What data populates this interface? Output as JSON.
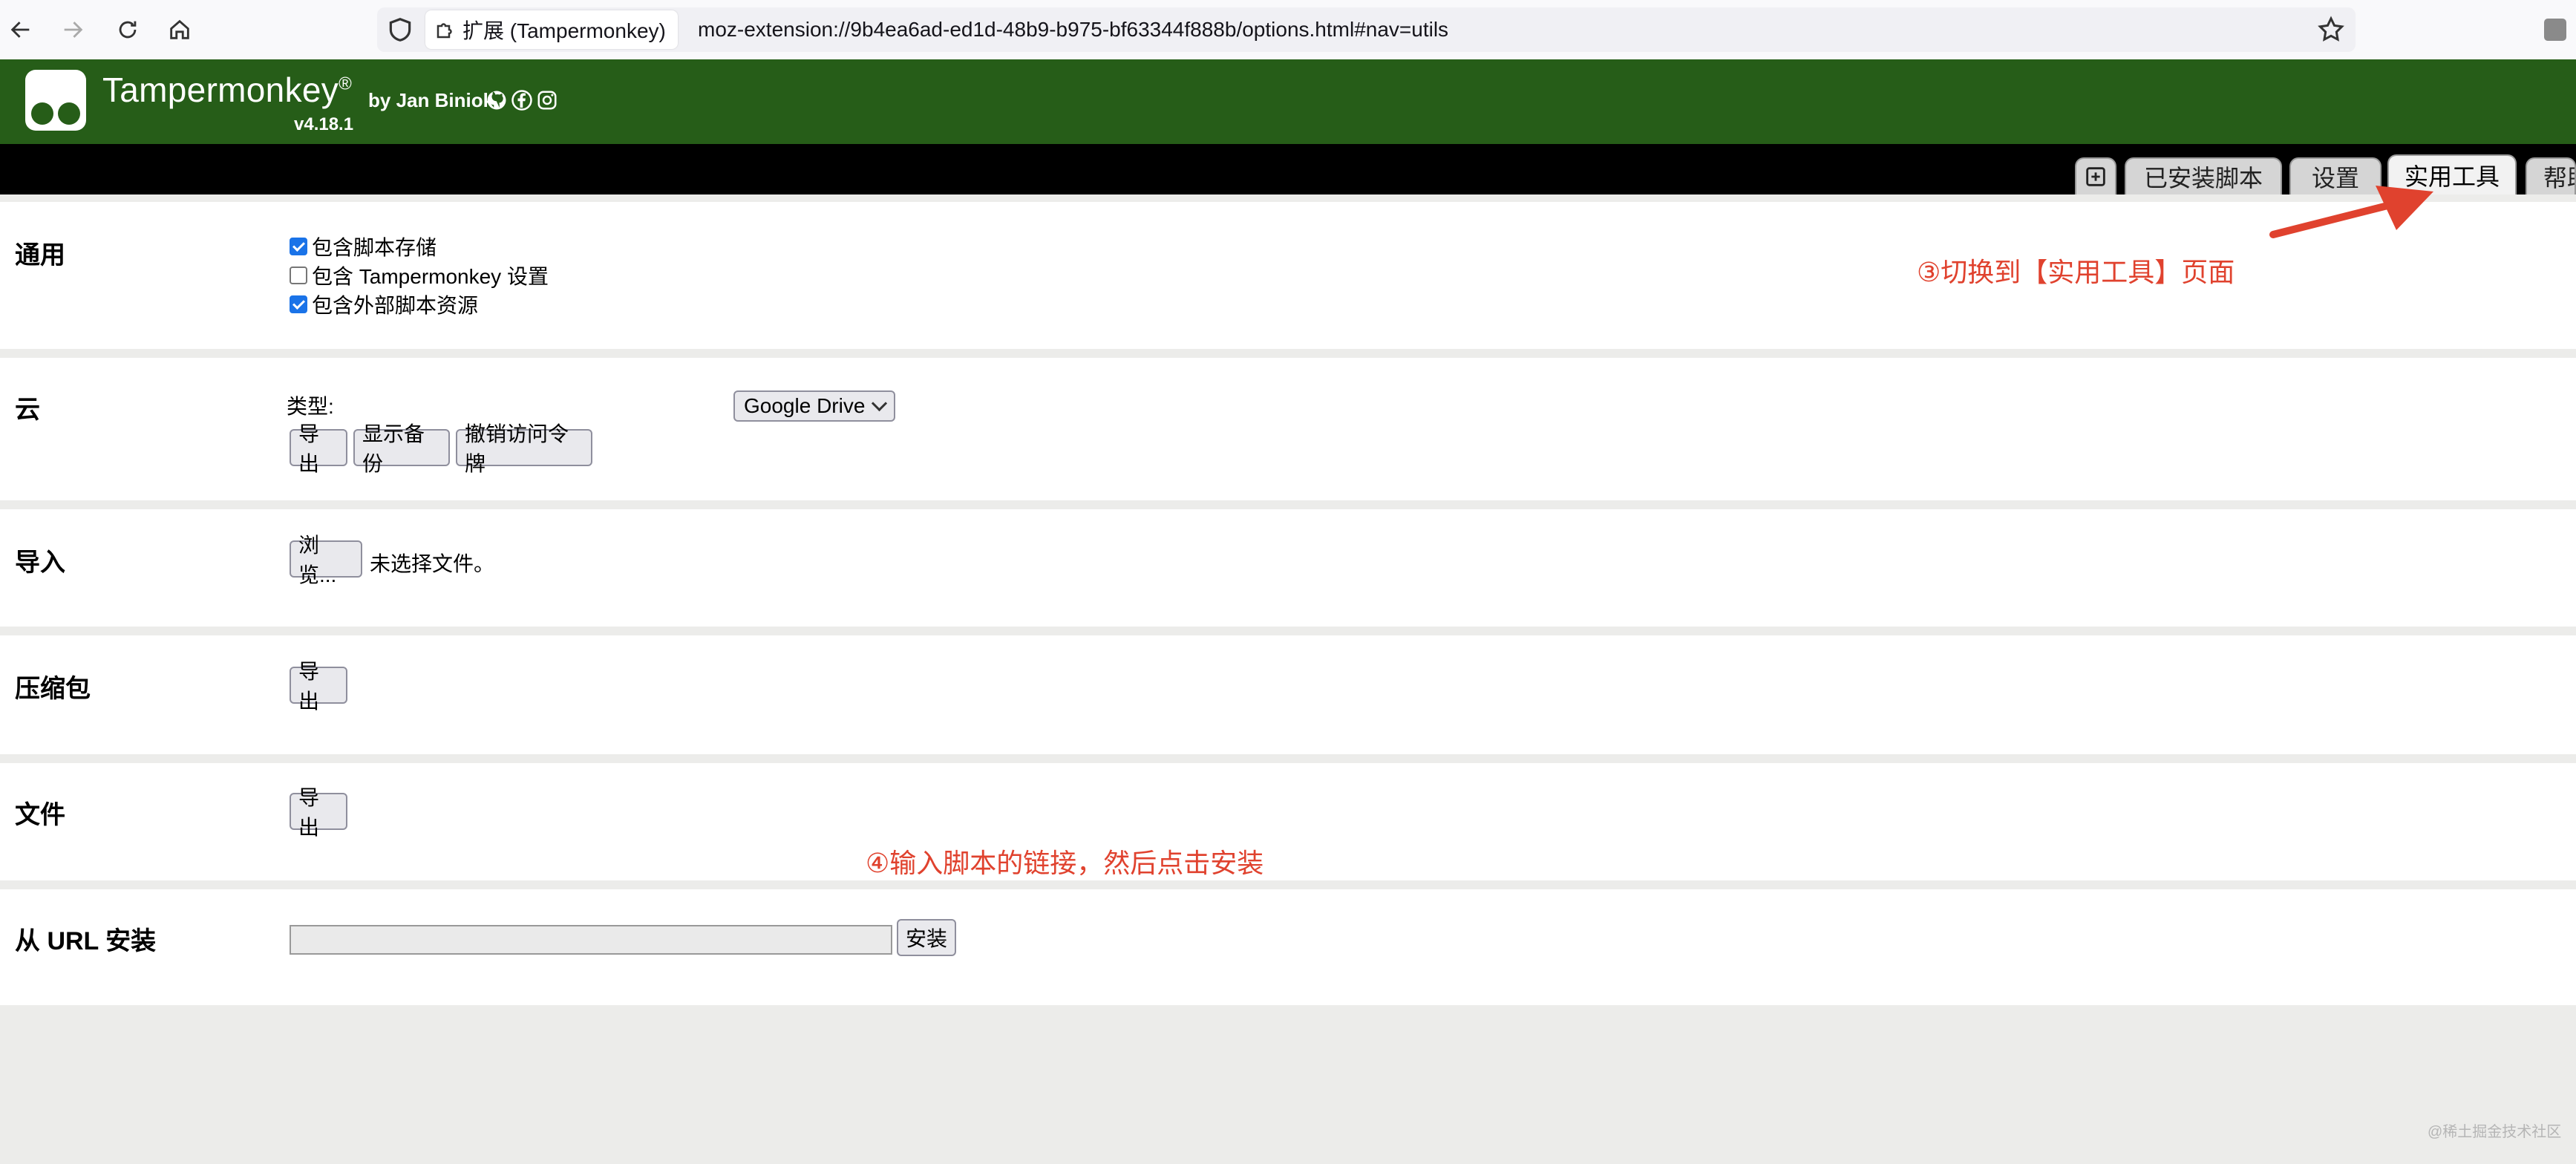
{
  "browser": {
    "identity_label": "扩展 (Tampermonkey)",
    "url": "moz-extension://9b4ea6ad-ed1d-48b9-b975-bf63344f888b/options.html#nav=utils"
  },
  "header": {
    "app_name": "Tampermonkey",
    "registered": "®",
    "byline": "by Jan Biniok",
    "version": "v4.18.1",
    "brand_color": "#265d18"
  },
  "tabs": [
    {
      "label": "已安装脚本"
    },
    {
      "label": "设置"
    },
    {
      "label": "实用工具",
      "active": true
    },
    {
      "label": "帮助"
    }
  ],
  "sections": {
    "general": {
      "title": "通用",
      "options": [
        {
          "label": "包含脚本存储",
          "checked": true
        },
        {
          "label": "包含 Tampermonkey 设置",
          "checked": false
        },
        {
          "label": "包含外部脚本资源",
          "checked": true
        }
      ]
    },
    "cloud": {
      "title": "云",
      "type_label": "类型:",
      "type_value": "Google Drive",
      "buttons": [
        "导出",
        "显示备份",
        "撤销访问令牌"
      ]
    },
    "import": {
      "title": "导入",
      "browse_label": "浏览...",
      "no_file_text": "未选择文件。"
    },
    "zip": {
      "title": "压缩包",
      "export_label": "导出"
    },
    "file": {
      "title": "文件",
      "export_label": "导出"
    },
    "url_install": {
      "title": "从 URL 安装",
      "input_value": "",
      "install_label": "安装"
    }
  },
  "annotations": {
    "step3": "③切换到【实用工具】页面",
    "step4": "④输入脚本的链接，然后点击安装",
    "color": "#e0422e"
  },
  "watermark": "@稀土掘金技术社区"
}
